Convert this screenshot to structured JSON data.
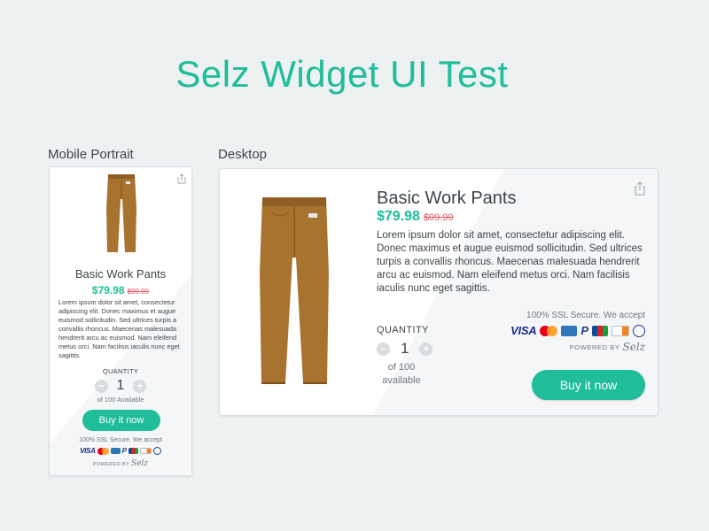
{
  "page": {
    "title": "Selz Widget UI Test"
  },
  "sections": {
    "mobile_label": "Mobile Portrait",
    "desktop_label": "Desktop"
  },
  "product": {
    "name": "Basic Work Pants",
    "price": "$79.98",
    "old_price": "$99.99",
    "image_icon": "pants-image"
  },
  "mobile": {
    "description": "Lorem ipsum dolor sit amet, consectetur adipiscing elit. Donec maximus et augue euismod sollicitudin. Sed ultrices turpis a convallis rhoncus. Maecenas malesuada hendrerit arcu ac euismod. Nam eleifend metus orci. Nam facilisis iaculis nunc eget sagittis.",
    "quantity_label": "QUANTITY",
    "quantity_value": "1",
    "availability": "of 100 Available",
    "buy_label": "Buy it now",
    "ssl_text": "100% SSL Secure. We accept",
    "powered_by": "POWERED BY",
    "brand": "Selz"
  },
  "desktop": {
    "description": "Lorem ipsum dolor sit amet, consectetur adipiscing elit. Donec maximus et augue euismod sollicitudin. Sed ultrices turpis a convallis rhoncus. Maecenas malesuada hendrerit arcu ac euismod. Nam eleifend metus orci. Nam facilisis iaculis nunc eget sagittis.",
    "quantity_label": "QUANTITY",
    "quantity_value": "1",
    "availability": "of 100 available",
    "buy_label": "Buy it now",
    "ssl_text": "100% SSL Secure. We accept",
    "powered_by": "POWERED BY",
    "brand": "Selz"
  },
  "payment_methods": [
    "visa",
    "mastercard",
    "amex",
    "paypal",
    "jcb",
    "discover",
    "diners-club"
  ],
  "colors": {
    "accent": "#1fbd99",
    "old_price": "#e05561",
    "background": "#eef1f2"
  }
}
